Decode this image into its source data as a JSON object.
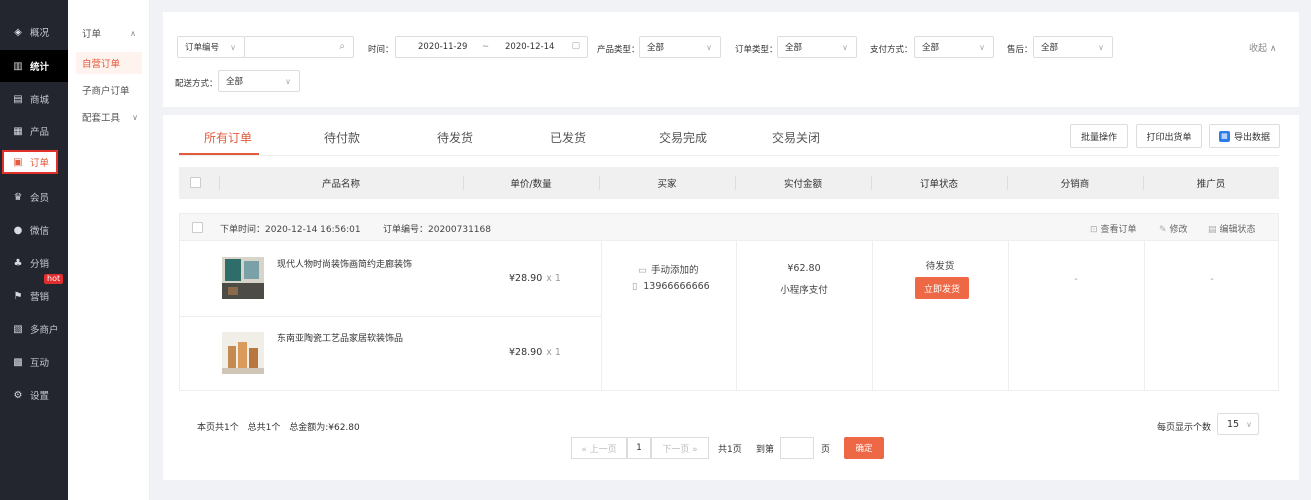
{
  "sidebar": {
    "items": [
      {
        "icon": "dashboard-icon",
        "glyph": "◈",
        "label": "概况"
      },
      {
        "icon": "chart-icon",
        "glyph": "▥",
        "label": "统计"
      },
      {
        "icon": "shop-icon",
        "glyph": "▤",
        "label": "商城"
      },
      {
        "icon": "grid-icon",
        "glyph": "▦",
        "label": "产品"
      },
      {
        "icon": "order-icon",
        "glyph": "▣",
        "label": "订单"
      },
      {
        "icon": "crown-icon",
        "glyph": "♛",
        "label": "会员"
      },
      {
        "icon": "wechat-icon",
        "glyph": "●",
        "label": "微信"
      },
      {
        "icon": "users-icon",
        "glyph": "♣",
        "label": "分销"
      },
      {
        "icon": "flag-icon",
        "glyph": "⚑",
        "label": "营销",
        "badge": "hot"
      },
      {
        "icon": "store-icon",
        "glyph": "▧",
        "label": "多商户"
      },
      {
        "icon": "interact-icon",
        "glyph": "▩",
        "label": "互动"
      },
      {
        "icon": "settings-icon",
        "glyph": "⚙",
        "label": "设置"
      }
    ]
  },
  "submenu": {
    "group_title": "订单",
    "items": [
      "自营订单",
      "子商户订单",
      "配套工具"
    ]
  },
  "filters": {
    "order_no_select": "订单编号",
    "time_label": "时间：",
    "date_start": "2020-11-29",
    "date_sep": "~",
    "date_end": "2020-12-14",
    "product_type_label": "产品类型：",
    "product_type_value": "全部",
    "order_type_label": "订单类型：",
    "order_type_value": "全部",
    "pay_method_label": "支付方式：",
    "pay_method_value": "全部",
    "after_sale_label": "售后：",
    "after_sale_value": "全部",
    "delivery_label": "配送方式：",
    "delivery_value": "全部",
    "collapse_label": "收起 ∧"
  },
  "tabs": [
    "所有订单",
    "待付款",
    "待发货",
    "已发货",
    "交易完成",
    "交易关闭"
  ],
  "toolbar": {
    "batch_label": "批量操作",
    "print_label": "打印出货单",
    "export_label": "导出数据"
  },
  "table": {
    "columns": [
      "产品名称",
      "单价/数量",
      "买家",
      "实付金额",
      "订单状态",
      "分销商",
      "推广员"
    ]
  },
  "order": {
    "time_label": "下单时间：2020-12-14 16:56:01",
    "order_no_label": "订单编号：20200731168",
    "actions": [
      "查看订单",
      "修改",
      "编辑状态"
    ],
    "products": [
      {
        "name": "现代人物时尚装饰画简约走廊装饰",
        "price": "¥28.90",
        "qty": "x 1"
      },
      {
        "name": "东南亚陶瓷工艺品家居软装饰品",
        "price": "¥28.90",
        "qty": "x 1"
      }
    ],
    "buyer_source": "手动添加的",
    "buyer_phone": "13966666666",
    "paid_amount": "¥62.80",
    "pay_channel": "小程序支付",
    "status": "待发货",
    "ship_button": "立即发货",
    "distributor": "-",
    "promoter": "-"
  },
  "summary": {
    "page_count": "本页共1个",
    "total_count": "总共1个",
    "total_amount": "总金额为:¥62.80"
  },
  "pagination": {
    "prev": "« 上一页",
    "current": "1",
    "next": "下一页 »",
    "total_pages": "共1页",
    "goto_label": "到第",
    "page_unit": "页",
    "confirm": "确定",
    "per_page_label": "每页显示个数",
    "per_page_value": "15"
  }
}
